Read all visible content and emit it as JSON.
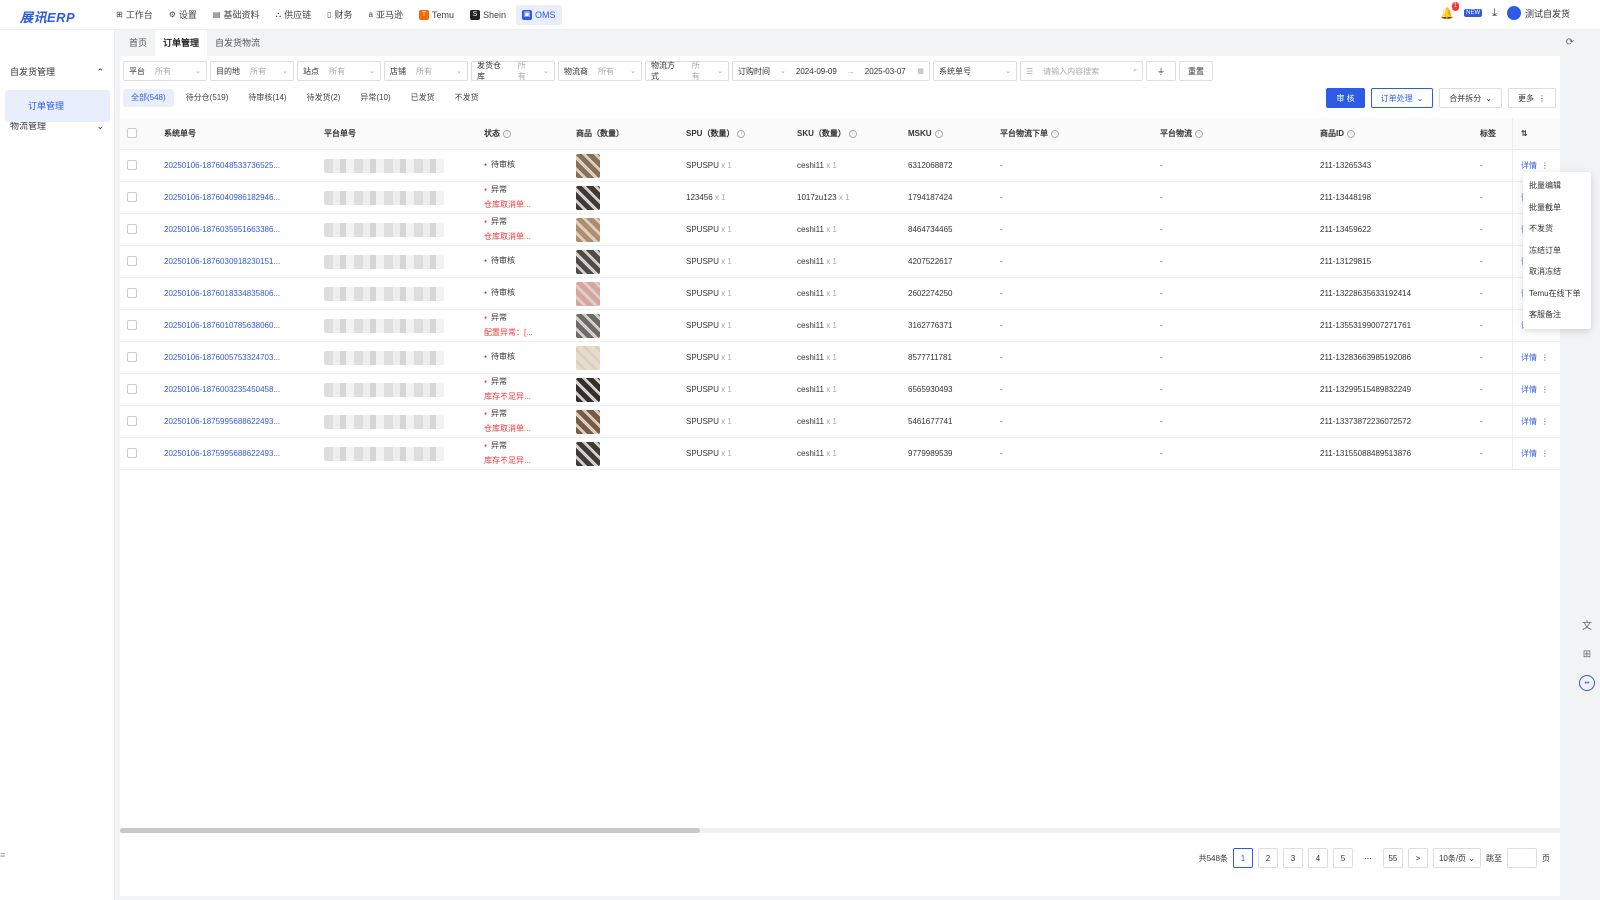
{
  "app": {
    "logo": "展讯ERP"
  },
  "nav": [
    {
      "label": "工作台",
      "icon": "⊞",
      "active": false
    },
    {
      "label": "设置",
      "icon": "⚙",
      "active": false
    },
    {
      "label": "基础资料",
      "icon": "▤",
      "active": false
    },
    {
      "label": "供应链",
      "icon": "⛬",
      "active": false
    },
    {
      "label": "财务",
      "icon": "▯",
      "active": false
    },
    {
      "label": "亚马逊",
      "icon": "a",
      "active": false
    },
    {
      "label": "Temu",
      "icon": "T",
      "active": false
    },
    {
      "label": "Shein",
      "icon": "S",
      "active": false
    },
    {
      "label": "OMS",
      "icon": "▣",
      "active": true
    }
  ],
  "topRight": {
    "notif_count": "1",
    "new_badge": "NEW",
    "user": "测试自发货"
  },
  "sidebar": {
    "groups": [
      {
        "label": "自发货管理",
        "chevron": "⌃"
      },
      {
        "label": "物流管理",
        "chevron": "⌄"
      }
    ],
    "active_item": "订单管理",
    "bottom_icon": "≡"
  },
  "tabs": [
    {
      "label": "首页"
    },
    {
      "label": "订单管理"
    },
    {
      "label": "自发货物流"
    }
  ],
  "filters": {
    "platform": {
      "label": "平台",
      "value": "所有"
    },
    "destination": {
      "label": "目的地",
      "value": "所有"
    },
    "site": {
      "label": "站点",
      "value": "所有"
    },
    "shop": {
      "label": "店铺",
      "value": "所有"
    },
    "warehouse": {
      "label": "发货仓库",
      "value": "所有"
    },
    "carrier": {
      "label": "物流商",
      "value": "所有"
    },
    "method": {
      "label": "物流方式",
      "value": "所有"
    },
    "date": {
      "label": "订购时间",
      "start": "2024-09-09",
      "end": "2025-03-07"
    },
    "search_type": "系统单号",
    "search_placeholder": "请输入内容搜索",
    "reset": "重置"
  },
  "status_tabs": [
    "全部(548)",
    "待分仓(519)",
    "待审核(14)",
    "待发货(2)",
    "异常(10)",
    "已发货",
    "不发货"
  ],
  "actions": {
    "approve": "审 核",
    "order_process": "订单处理",
    "merge_split": "合并拆分",
    "more": "更多"
  },
  "dropdown": [
    "批量编辑",
    "批量截单",
    "不发货",
    "冻结订单",
    "取消冻结",
    "Temu在线下单",
    "客服备注"
  ],
  "columns": {
    "sys_no": "系统单号",
    "platform_no": "平台单号",
    "status": "状态",
    "goods": "商品（数量）",
    "spu": "SPU（数量）",
    "sku": "SKU（数量）",
    "msku": "MSKU",
    "plat_order": "平台物流下单",
    "plat_logistics": "平台物流",
    "goods_id": "商品ID",
    "tag": "标签"
  },
  "rows": [
    {
      "sys_no": "20250106-1876048533736525...",
      "status": "待审核",
      "status_sub": "",
      "spu": "SPUSPU",
      "spu_qty": "x 1",
      "sku": "ceshi11",
      "sku_qty": "x 1",
      "msku": "6312068872",
      "plat_order": "-",
      "plat_logistics": "-",
      "goods_id": "211-13265343",
      "tag": "-",
      "detail": "详情",
      "more": "⋮",
      "thumb_color": "#8a6f58",
      "error": false
    },
    {
      "sys_no": "20250106-1876040986182946...",
      "status": "异常",
      "status_sub": "仓库取消单...",
      "spu": "123456",
      "spu_qty": "x 1",
      "sku": "1017zu123",
      "sku_qty": "x 1",
      "msku": "1794187424",
      "plat_order": "-",
      "plat_logistics": "-",
      "goods_id": "211-13448198",
      "tag": "-",
      "detail": "详情",
      "more": "⋮",
      "thumb_color": "#3a3a3a",
      "error": true
    },
    {
      "sys_no": "20250106-1876035951663386...",
      "status": "异常",
      "status_sub": "仓库取消单...",
      "spu": "SPUSPU",
      "spu_qty": "x 1",
      "sku": "ceshi11",
      "sku_qty": "x 1",
      "msku": "8464734465",
      "plat_order": "-",
      "plat_logistics": "-",
      "goods_id": "211-13459622",
      "tag": "-",
      "detail": "详情",
      "more": "⋮",
      "thumb_color": "#b08d6a",
      "error": true
    },
    {
      "sys_no": "20250106-1876030918230151...",
      "status": "待审核",
      "status_sub": "",
      "spu": "SPUSPU",
      "spu_qty": "x 1",
      "sku": "ceshi11",
      "sku_qty": "x 1",
      "msku": "4207522617",
      "plat_order": "-",
      "plat_logistics": "-",
      "goods_id": "211-13129815",
      "tag": "-",
      "detail": "详情",
      "more": "⋮",
      "thumb_color": "#4b4b4b",
      "error": false
    },
    {
      "sys_no": "20250106-1876018334835806...",
      "status": "待审核",
      "status_sub": "",
      "spu": "SPUSPU",
      "spu_qty": "x 1",
      "sku": "ceshi11",
      "sku_qty": "x 1",
      "msku": "2602274250",
      "plat_order": "-",
      "plat_logistics": "-",
      "goods_id": "211-13228635633192414",
      "tag": "-",
      "detail": "详情",
      "more": "⋮",
      "thumb_color": "#d9a3a3",
      "error": false
    },
    {
      "sys_no": "20250106-1876010785638060...",
      "status": "异常",
      "status_sub": "配置异常：[...",
      "spu": "SPUSPU",
      "spu_qty": "x 1",
      "sku": "ceshi11",
      "sku_qty": "x 1",
      "msku": "3162776371",
      "plat_order": "-",
      "plat_logistics": "-",
      "goods_id": "211-13553199007271761",
      "tag": "-",
      "detail": "详情",
      "more": "⋮",
      "thumb_color": "#6b6b6b",
      "error": true
    },
    {
      "sys_no": "20250106-1876005753324703...",
      "status": "待审核",
      "status_sub": "",
      "spu": "SPUSPU",
      "spu_qty": "x 1",
      "sku": "ceshi11",
      "sku_qty": "x 1",
      "msku": "8577711781",
      "plat_order": "-",
      "plat_logistics": "-",
      "goods_id": "211-13283663985192086",
      "tag": "-",
      "detail": "详情",
      "more": "⋮",
      "thumb_color": "#e6dcc8",
      "error": false
    },
    {
      "sys_no": "20250106-1876003235450458...",
      "status": "异常",
      "status_sub": "库存不足异...",
      "spu": "SPUSPU",
      "spu_qty": "x 1",
      "sku": "ceshi11",
      "sku_qty": "x 1",
      "msku": "6565930493",
      "plat_order": "-",
      "plat_logistics": "-",
      "goods_id": "211-13299515489832249",
      "tag": "-",
      "detail": "详情",
      "more": "⋮",
      "thumb_color": "#2f2f2f",
      "error": true
    },
    {
      "sys_no": "20250106-1875995688622493...",
      "status": "异常",
      "status_sub": "仓库取消单...",
      "spu": "SPUSPU",
      "spu_qty": "x 1",
      "sku": "ceshi11",
      "sku_qty": "x 1",
      "msku": "5461677741",
      "plat_order": "-",
      "plat_logistics": "-",
      "goods_id": "211-13373872236072572",
      "tag": "-",
      "detail": "详情",
      "more": "⋮",
      "thumb_color": "#7a5a45",
      "error": true
    },
    {
      "sys_no": "20250106-1875995688622493...",
      "status": "异常",
      "status_sub": "库存不足异...",
      "spu": "SPUSPU",
      "spu_qty": "x 1",
      "sku": "ceshi11",
      "sku_qty": "x 1",
      "msku": "9779989539",
      "plat_order": "-",
      "plat_logistics": "-",
      "goods_id": "211-13155088489513876",
      "tag": "-",
      "detail": "详情",
      "more": "⋮",
      "thumb_color": "#3c3c3c",
      "error": true
    }
  ],
  "pagination": {
    "total": "共548条",
    "pages": [
      "1",
      "2",
      "3",
      "4",
      "5"
    ],
    "ellipsis": "···",
    "last": "55",
    "next": ">",
    "page_size": "10条/页",
    "jump_label": "跳至",
    "page_unit": "页"
  },
  "colors": {
    "accent": "#2d5be3",
    "error": "#f33"
  }
}
